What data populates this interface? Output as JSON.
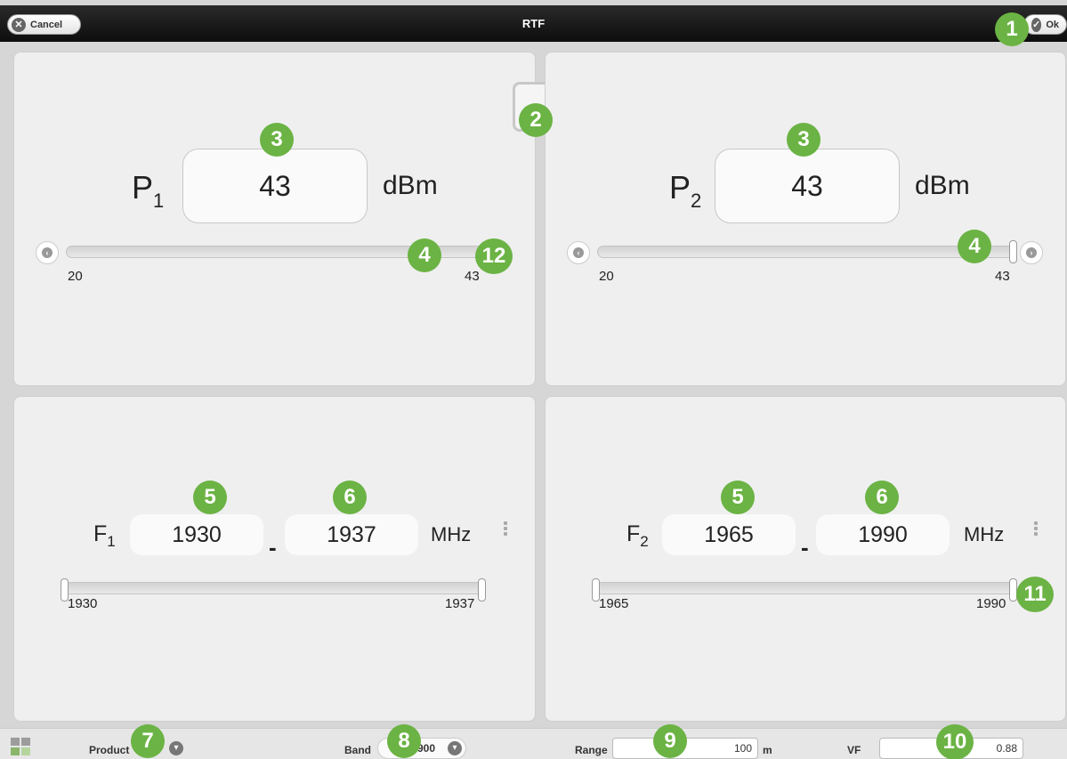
{
  "topbar": {
    "title": "RTF",
    "cancel_label": "Cancel",
    "ok_label": "Ok"
  },
  "power": [
    {
      "label": "P",
      "sub": "1",
      "value": "43",
      "unit": "dBm",
      "min_label": "20",
      "max_label": "43"
    },
    {
      "label": "P",
      "sub": "2",
      "value": "43",
      "unit": "dBm",
      "min_label": "20",
      "max_label": "43"
    }
  ],
  "frequency": [
    {
      "label": "F",
      "sub": "1",
      "low": "1930",
      "high": "1937",
      "dash": "-",
      "unit": "MHz",
      "min_label": "1930",
      "max_label": "1937"
    },
    {
      "label": "F",
      "sub": "2",
      "low": "1965",
      "high": "1990",
      "dash": "-",
      "unit": "MHz",
      "min_label": "1965",
      "max_label": "1990"
    }
  ],
  "bottombar": {
    "product_label": "Product",
    "band_label": "Band",
    "band_value": "900",
    "range_label": "Range",
    "range_value": "100",
    "range_unit": "m",
    "vf_label": "VF",
    "vf_value": "0.88"
  },
  "markers": [
    "1",
    "2",
    "3",
    "3",
    "4",
    "4",
    "5",
    "6",
    "5",
    "6",
    "7",
    "8",
    "9",
    "10",
    "11",
    "12"
  ],
  "colors": {
    "marker": "#6bb344",
    "topbar": "#111111",
    "panel": "#efefef"
  }
}
